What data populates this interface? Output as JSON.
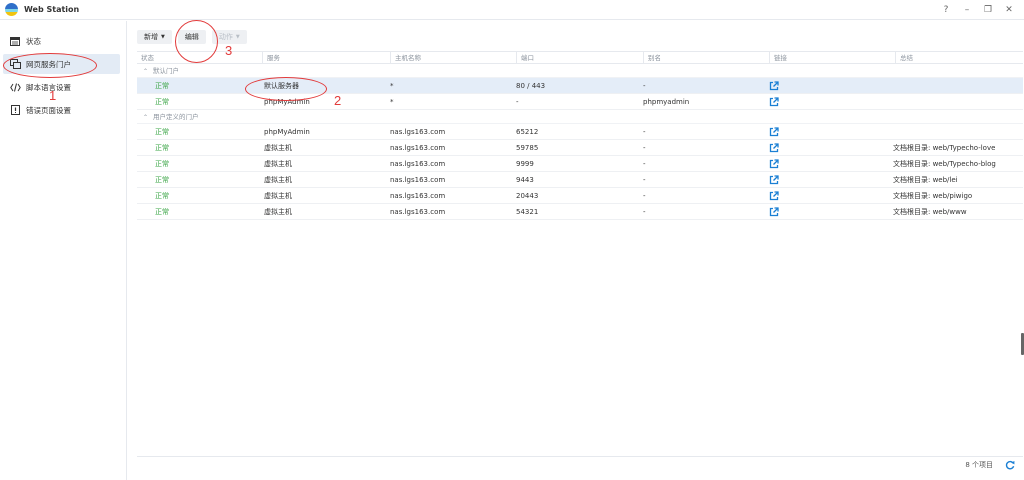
{
  "window": {
    "title": "Web Station",
    "controls": [
      "?",
      "–",
      "❐",
      "✕"
    ]
  },
  "sidebar": {
    "items": [
      {
        "label": "状态",
        "icon": "status-icon"
      },
      {
        "label": "网页服务门户",
        "icon": "web-portal-icon",
        "active": true
      },
      {
        "label": "脚本语言设置",
        "icon": "code-icon"
      },
      {
        "label": "错误页面设置",
        "icon": "error-icon"
      }
    ]
  },
  "toolbar": {
    "create_label": "新增",
    "edit_label": "编辑",
    "action_label": "动作",
    "caret": "▼"
  },
  "table": {
    "columns": [
      "状态",
      "服务",
      "主机名称",
      "端口",
      "别名",
      "链接",
      "总结"
    ],
    "groups": [
      {
        "label": "默认门户",
        "rows": [
          {
            "status": "正常",
            "service": "默认服务器",
            "host": "*",
            "port": "80 / 443",
            "alias": "-",
            "summary": ""
          },
          {
            "status": "正常",
            "service": "phpMyAdmin",
            "host": "*",
            "port": "-",
            "alias": "phpmyadmin",
            "summary": ""
          }
        ]
      },
      {
        "label": "用户定义的门户",
        "rows": [
          {
            "status": "正常",
            "service": "phpMyAdmin",
            "host": "nas.lgs163.com",
            "port": "65212",
            "alias": "-",
            "summary": ""
          },
          {
            "status": "正常",
            "service": "虚拟主机",
            "host": "nas.lgs163.com",
            "port": "59785",
            "alias": "-",
            "summary": "文档根目录: web/Typecho-love"
          },
          {
            "status": "正常",
            "service": "虚拟主机",
            "host": "nas.lgs163.com",
            "port": "9999",
            "alias": "-",
            "summary": "文档根目录: web/Typecho-blog"
          },
          {
            "status": "正常",
            "service": "虚拟主机",
            "host": "nas.lgs163.com",
            "port": "9443",
            "alias": "-",
            "summary": "文档根目录: web/lei"
          },
          {
            "status": "正常",
            "service": "虚拟主机",
            "host": "nas.lgs163.com",
            "port": "20443",
            "alias": "-",
            "summary": "文档根目录: web/piwigo"
          },
          {
            "status": "正常",
            "service": "虚拟主机",
            "host": "nas.lgs163.com",
            "port": "54321",
            "alias": "-",
            "summary": "文档根目录: web/www"
          }
        ]
      }
    ]
  },
  "footer": {
    "count": "8 个项目"
  },
  "annotations": {
    "n1": "1",
    "n2": "2",
    "n3": "3"
  },
  "colors": {
    "status_ok": "#3aa545",
    "link": "#1a7fd4",
    "annotation": "#e23b3b",
    "selected_row": "#e4edf8"
  }
}
